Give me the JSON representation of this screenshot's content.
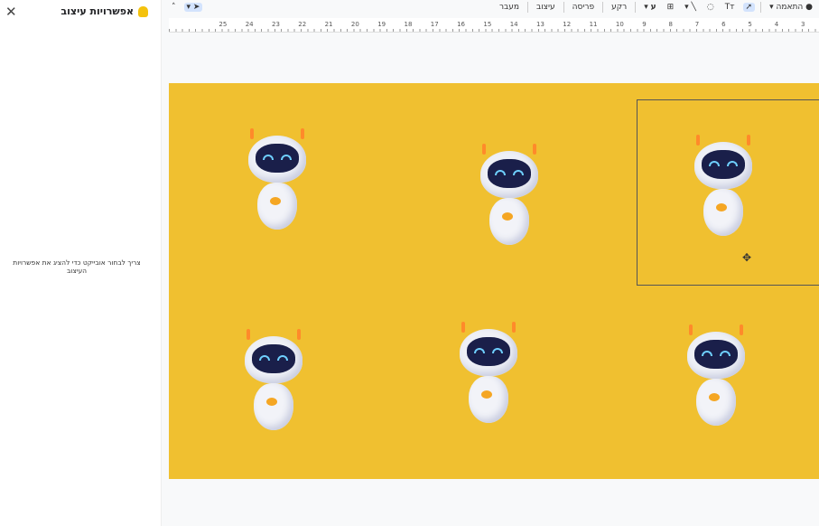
{
  "panel": {
    "title": "אפשרויות עיצוב",
    "close_icon": "close-icon",
    "bulb_icon": "lightbulb-icon",
    "hint": "צריך לבחור אובייקט כדי להציג את אפשרויות העיצוב"
  },
  "toolbar": {
    "fit": "התאמה",
    "background": "רקע",
    "layout": "פריסה",
    "theme": "עיצוב",
    "transition": "מעבר"
  },
  "ruler": [
    "3",
    "4",
    "5",
    "6",
    "7",
    "8",
    "9",
    "10",
    "11",
    "12",
    "13",
    "14",
    "15",
    "16",
    "17",
    "18",
    "19",
    "20",
    "21",
    "22",
    "23",
    "24",
    "25"
  ],
  "colors": {
    "slide": "#f0c030"
  }
}
